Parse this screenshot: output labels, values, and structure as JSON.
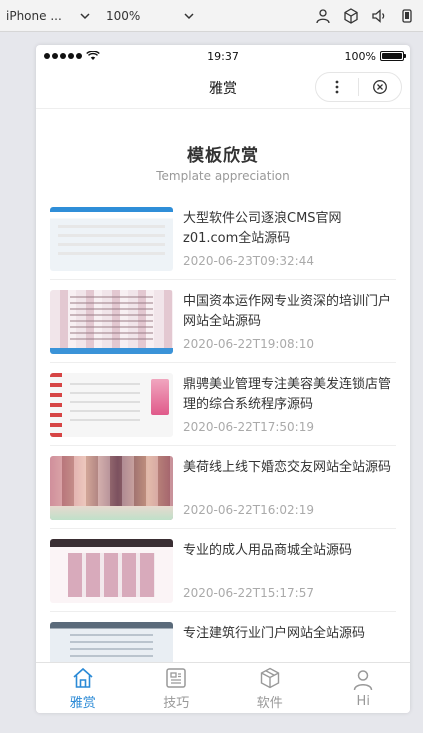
{
  "devtools": {
    "device": "iPhone ...",
    "zoom": "100%"
  },
  "status_bar": {
    "time": "19:37",
    "battery": "100%",
    "battery_level": 1.0
  },
  "navbar": {
    "title": "雅赏"
  },
  "section": {
    "title": "模板欣赏",
    "subtitle": "Template appreciation"
  },
  "items": [
    {
      "title": "大型软件公司逐浪CMS官网z01.com全站源码",
      "date": "2020-06-23T09:32:44"
    },
    {
      "title": "中国资本运作网专业资深的培训门户网站全站源码",
      "date": "2020-06-22T19:08:10"
    },
    {
      "title": "鼎骋美业管理专注美容美发连锁店管理的综合系统程序源码",
      "date": "2020-06-22T17:50:19"
    },
    {
      "title": "美荷线上线下婚恋交友网站全站源码",
      "date": "2020-06-22T16:02:19"
    },
    {
      "title": "专业的成人用品商城全站源码",
      "date": "2020-06-22T15:17:57"
    },
    {
      "title": "专注建筑行业门户网站全站源码",
      "date": ""
    }
  ],
  "tabbar": {
    "tabs": [
      {
        "label": "雅赏",
        "icon": "home-icon",
        "active": true
      },
      {
        "label": "技巧",
        "icon": "news-icon",
        "active": false
      },
      {
        "label": "软件",
        "icon": "box-icon",
        "active": false
      },
      {
        "label": "Hi",
        "icon": "user-icon",
        "active": false
      }
    ],
    "active_color": "#2b8ad6",
    "inactive_color": "#999999"
  }
}
